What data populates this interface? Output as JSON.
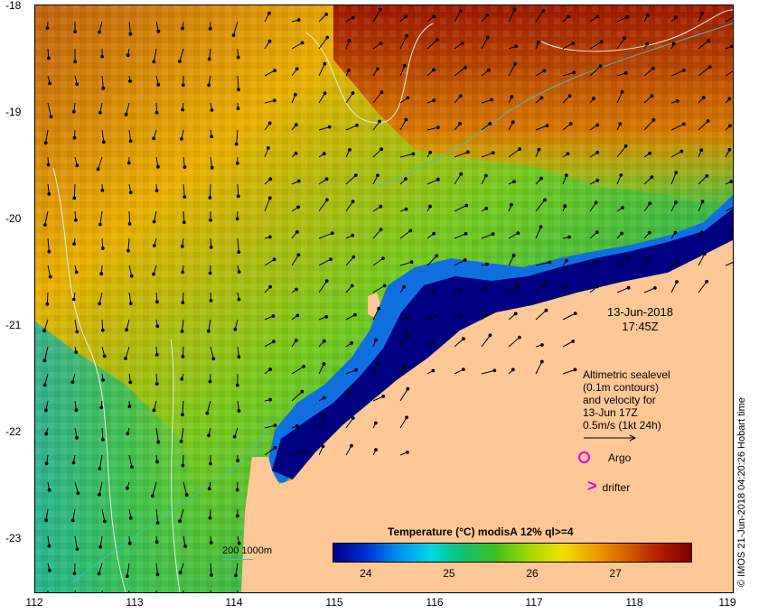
{
  "map": {
    "lon_range": [
      112,
      119
    ],
    "lat_range": [
      -23.5,
      -18.0
    ],
    "x_ticks": [
      "112",
      "113",
      "114",
      "115",
      "116",
      "117",
      "118",
      "119"
    ],
    "y_ticks": [
      "-18",
      "-19",
      "-20",
      "-21",
      "-22",
      "-23"
    ],
    "land_color": "#fec896",
    "contour_color": "#e8f0e8",
    "isobath_color": "#40c0c0"
  },
  "annotations": {
    "date": "13-Jun-2018",
    "time": "17:45Z",
    "velocity_lines": [
      "Altimetric sealevel",
      "(0.1m contours)",
      "and velocity for",
      "13-Jun 17Z",
      "0.5m/s (1kt 24h)"
    ],
    "argo_label": "Argo",
    "drifter_label": "drifter",
    "drifter_symbol": ">",
    "isobath_label": "200  1000m",
    "credit": "© IMOS 21-Jun-2018 04:20:26 Hobart time"
  },
  "colorbar": {
    "title": "Temperature (°C) modisA 12% ql>=4",
    "range": [
      23.6,
      27.9
    ],
    "tick_labels": [
      "24",
      "25",
      "26",
      "27"
    ],
    "tick_values": [
      24,
      25,
      26,
      27
    ],
    "stops": [
      "#00008c",
      "#0030d0",
      "#0090f0",
      "#00d8e0",
      "#10c070",
      "#40c020",
      "#a0d800",
      "#f0e000",
      "#f0a000",
      "#d86000",
      "#b02000",
      "#800000"
    ]
  }
}
